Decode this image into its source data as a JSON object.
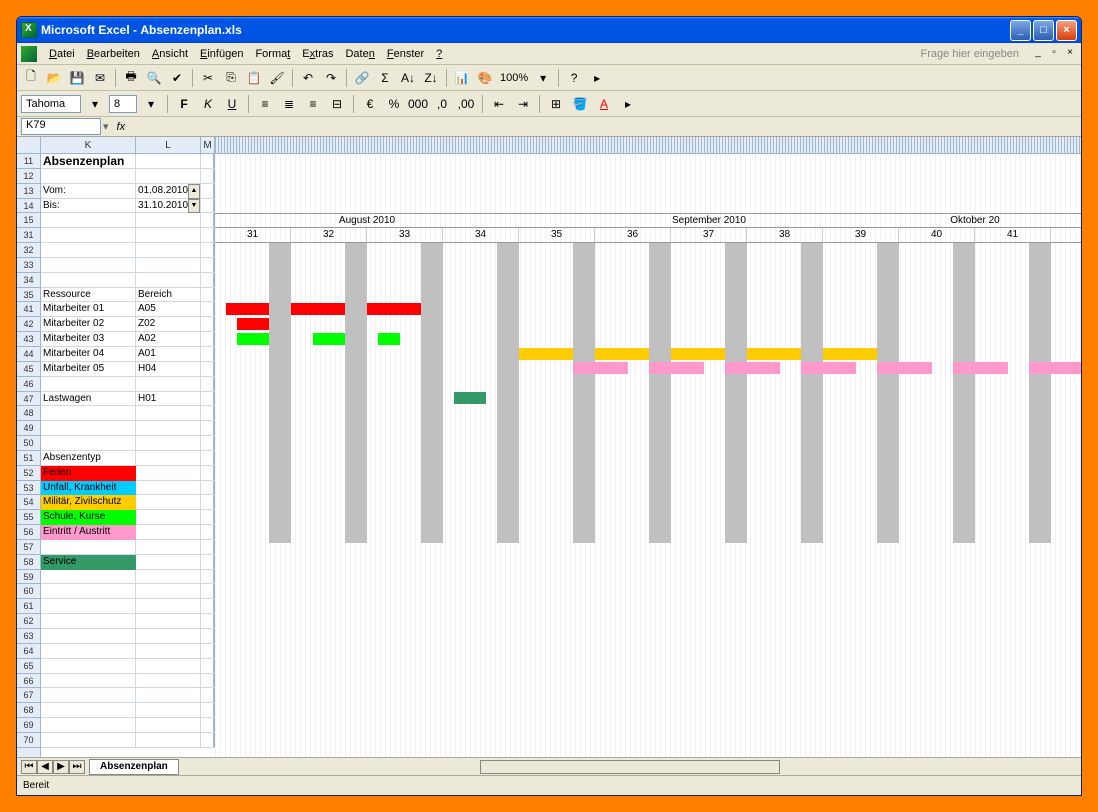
{
  "titlebar": {
    "app": "Microsoft Excel",
    "file": "Absenzenplan.xls"
  },
  "menu": {
    "items": [
      "Datei",
      "Bearbeiten",
      "Ansicht",
      "Einfügen",
      "Format",
      "Extras",
      "Daten",
      "Fenster",
      "?"
    ],
    "help_prompt": "Frage hier eingeben"
  },
  "toolbar": {
    "zoom": "100%"
  },
  "format": {
    "font": "Tahoma",
    "size": "8"
  },
  "namebox": {
    "ref": "K79",
    "fx": "fx"
  },
  "columns": [
    "K",
    "L",
    "M"
  ],
  "rows_visible": [
    11,
    12,
    13,
    14,
    15,
    31,
    32,
    33,
    34,
    35,
    41,
    42,
    43,
    44,
    45,
    46,
    47,
    48,
    49,
    50,
    51,
    52,
    53,
    54,
    55,
    56,
    57,
    58,
    59,
    60,
    61,
    62,
    63,
    64,
    65,
    66,
    67,
    68,
    69,
    70
  ],
  "sheet": {
    "title": "Absenzenplan",
    "vom_label": "Vom:",
    "vom": "01.08.2010",
    "bis_label": "Bis:",
    "bis": "31.10.2010",
    "ressource_hdr": "Ressource",
    "bereich_hdr": "Bereich",
    "employees": [
      {
        "name": "Mitarbeiter 01",
        "bereich": "A05"
      },
      {
        "name": "Mitarbeiter 02",
        "bereich": "Z02"
      },
      {
        "name": "Mitarbeiter 03",
        "bereich": "A02"
      },
      {
        "name": "Mitarbeiter 04",
        "bereich": "A01"
      },
      {
        "name": "Mitarbeiter 05",
        "bereich": "H04"
      }
    ],
    "lastwagen": {
      "name": "Lastwagen",
      "bereich": "H01"
    },
    "legend_hdr": "Absenzentyp",
    "legend": [
      {
        "label": "Ferien",
        "color": "c-red"
      },
      {
        "label": "Unfall, Krankheit",
        "color": "c-cyan"
      },
      {
        "label": "Militär, Zivilschutz",
        "color": "c-orange"
      },
      {
        "label": "Schule, Kurse",
        "color": "c-green"
      },
      {
        "label": "Eintritt / Austritt",
        "color": "c-pink"
      }
    ],
    "service": {
      "label": "Service",
      "color": "c-teal"
    }
  },
  "timeline": {
    "months": [
      {
        "label": "August 2010",
        "weeks": [
          "31",
          "32",
          "33",
          "34"
        ]
      },
      {
        "label": "September 2010",
        "weeks": [
          "35",
          "36",
          "37",
          "38",
          "39"
        ]
      },
      {
        "label": "Oktober 20",
        "weeks": [
          "40",
          "41"
        ]
      }
    ]
  },
  "status": "Bereit",
  "tab": "Absenzenplan"
}
